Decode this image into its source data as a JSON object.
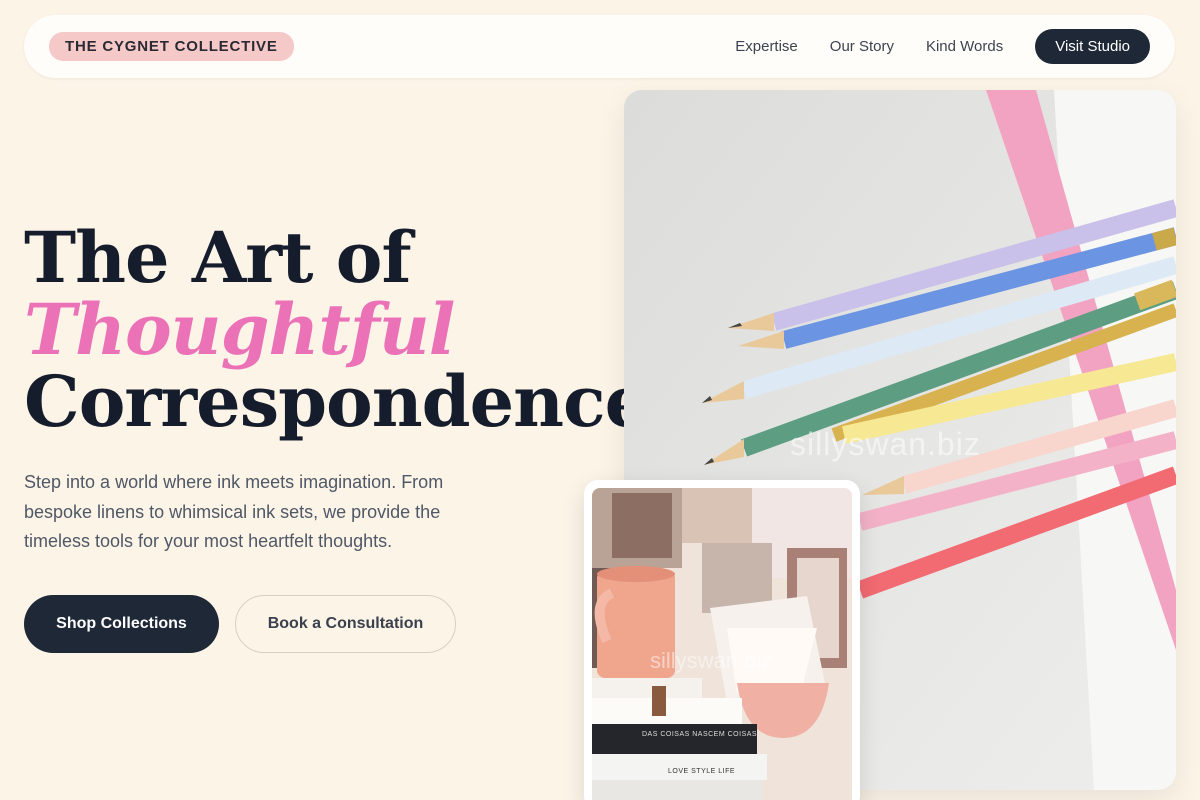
{
  "nav": {
    "brand": "THE CYGNET COLLECTIVE",
    "links": [
      "Expertise",
      "Our Story",
      "Kind Words"
    ],
    "cta": "Visit Studio"
  },
  "hero": {
    "title_line1": "The Art of",
    "title_accent": "Thoughtful",
    "title_line3": "Correspondence.",
    "body": "Step into a world where ink meets imagination. From bespoke linens to whimsical ink sets, we provide the timeless tools for your most heartfelt thoughts.",
    "primary_button": "Shop Collections",
    "secondary_button": "Book a Consultation"
  },
  "images": {
    "main_watermark": "sillyswan.biz",
    "small_watermark": "sillyswan.biz",
    "book_labels": [
      "DAS COISAS NASCEM COISAS",
      "LOVE  STYLE  LIFE"
    ]
  },
  "colors": {
    "background": "#fdf4e8",
    "accent_pink": "#ec72b8",
    "dark": "#1e2837",
    "brand_badge": "#f6c9c9"
  }
}
